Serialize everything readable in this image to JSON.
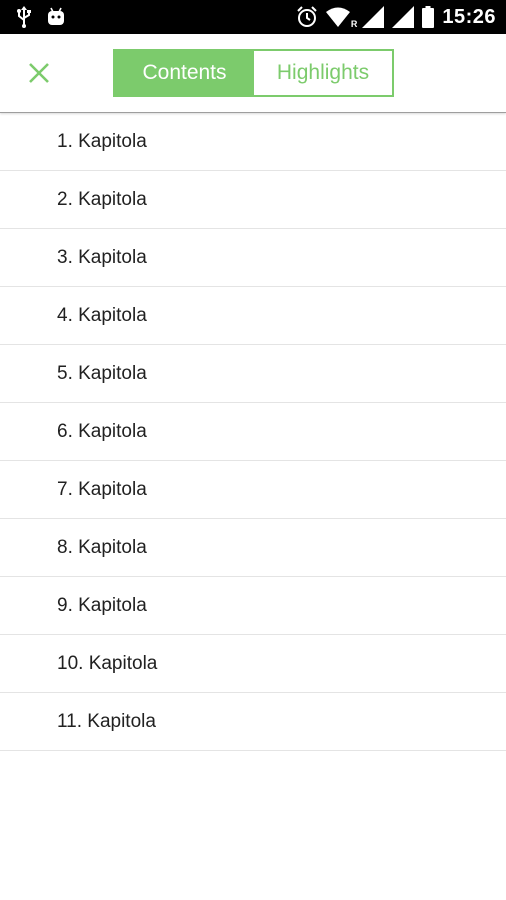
{
  "status_bar": {
    "time": "15:26",
    "left_icons": [
      "usb-icon",
      "android-icon"
    ],
    "right_icons": [
      "alarm-icon",
      "wifi-icon",
      "cell-signal-icon",
      "battery-icon"
    ],
    "roaming_mark": "R"
  },
  "toolbar": {
    "close_icon": "close-icon",
    "tabs": [
      {
        "label": "Contents",
        "active": true
      },
      {
        "label": "Highlights",
        "active": false
      }
    ]
  },
  "chapters": [
    {
      "label": "1. Kapitola"
    },
    {
      "label": "2. Kapitola"
    },
    {
      "label": "3. Kapitola"
    },
    {
      "label": "4. Kapitola"
    },
    {
      "label": "5. Kapitola"
    },
    {
      "label": "6. Kapitola"
    },
    {
      "label": "7. Kapitola"
    },
    {
      "label": "8. Kapitola"
    },
    {
      "label": "9. Kapitola"
    },
    {
      "label": "10. Kapitola"
    },
    {
      "label": "11. Kapitola"
    }
  ],
  "colors": {
    "accent": "#7ccb6c",
    "status_bar_bg": "#000000",
    "text": "#212121",
    "divider": "#e4e4e4"
  }
}
